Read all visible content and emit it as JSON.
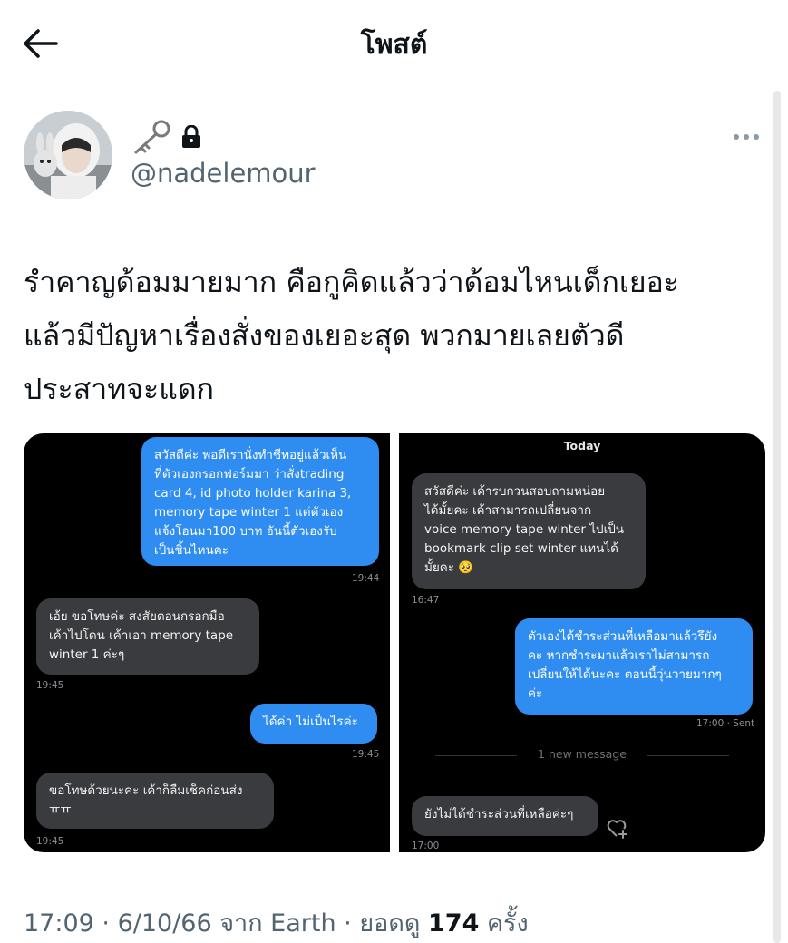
{
  "header": {
    "title": "โพสต์",
    "back_icon": "arrow-left-icon"
  },
  "author": {
    "handle": "@nadelemour",
    "badges": [
      "key-icon",
      "lock-icon"
    ]
  },
  "post": {
    "lines": [
      "รำคาญด้อมมายมาก คือกูคิดแล้วว่าด้อมไหนเด็กเยอะ",
      "แล้วมีปัญหาเรื่องสั่งของเยอะสุด พวกมายเลยตัวดี",
      "ประสาทจะแดก"
    ]
  },
  "chat_left": {
    "messages": [
      {
        "type": "sent",
        "text": "สวัสดีค่ะ พอดีเรานั่งทำชีทอยู่แล้วเห็น\nที่ตัวเองกรอกฟอร์มมา ว่าสั่งtrading\ncard 4, id photo holder karina 3,\nmemory tape winter 1 แต่ตัวเอง\nแจ้งโอนมา100 บาท อันนี้ตัวเองรับ\nเป็นชิ้นไหนคะ",
        "time": "19:44"
      },
      {
        "type": "received",
        "text": "เอ้ย ขอโทษค่ะ สงสัยตอนกรอกมือ\nเค้าไปโดน เค้าเอา memory tape\nwinter 1 ค่ะๆ",
        "time": "19:45"
      },
      {
        "type": "sent",
        "text": "ได้ค่า ไม่เป็นไรค่ะ",
        "time": "19:45"
      },
      {
        "type": "received",
        "text": "ขอโทษด้วยนะคะ เค้าก็ลืมเช็คก่อนส่ง\nㅠㅠ",
        "time": "19:45"
      }
    ]
  },
  "chat_right": {
    "day_label": "Today",
    "messages": [
      {
        "type": "received",
        "text": "สวัสดีค่ะ เค้ารบกวนสอบถามหน่อย\nได้มั้ยคะ เค้าสามารถเปลี่ยนจาก\nvoice memory tape winter ไปเป็น\nbookmark clip set winter แทนได้\nมั้ยคะ 🥺",
        "time": "16:47"
      },
      {
        "type": "sent",
        "text": "ตัวเองได้ชำระส่วนที่เหลือมาแล้วรึยัง\nคะ หากชำระมาแล้วเราไม่สามารถ\nเปลี่ยนให้ได้นะคะ ตอนนี้วุ่นวายมากๆ\nค่ะ",
        "time": "17:00 · Sent"
      },
      {
        "type": "received",
        "text": "ยังไม่ได้ชำระส่วนที่เหลือค่ะๆ",
        "time": "17:00"
      }
    ],
    "divider": "1 new message",
    "react_icon": "heart-plus-icon"
  },
  "meta": {
    "time": "17:09",
    "sep1": " · ",
    "date": "6/10/66",
    "source": " จาก Earth",
    "sep2": " · ",
    "views_label": "ยอดดู ",
    "views": "174",
    "views_suffix": " ครั้ง"
  },
  "colors": {
    "sent_bubble": "#2f8df2",
    "received_bubble": "#3a3b3f",
    "muted_text": "#536471"
  }
}
